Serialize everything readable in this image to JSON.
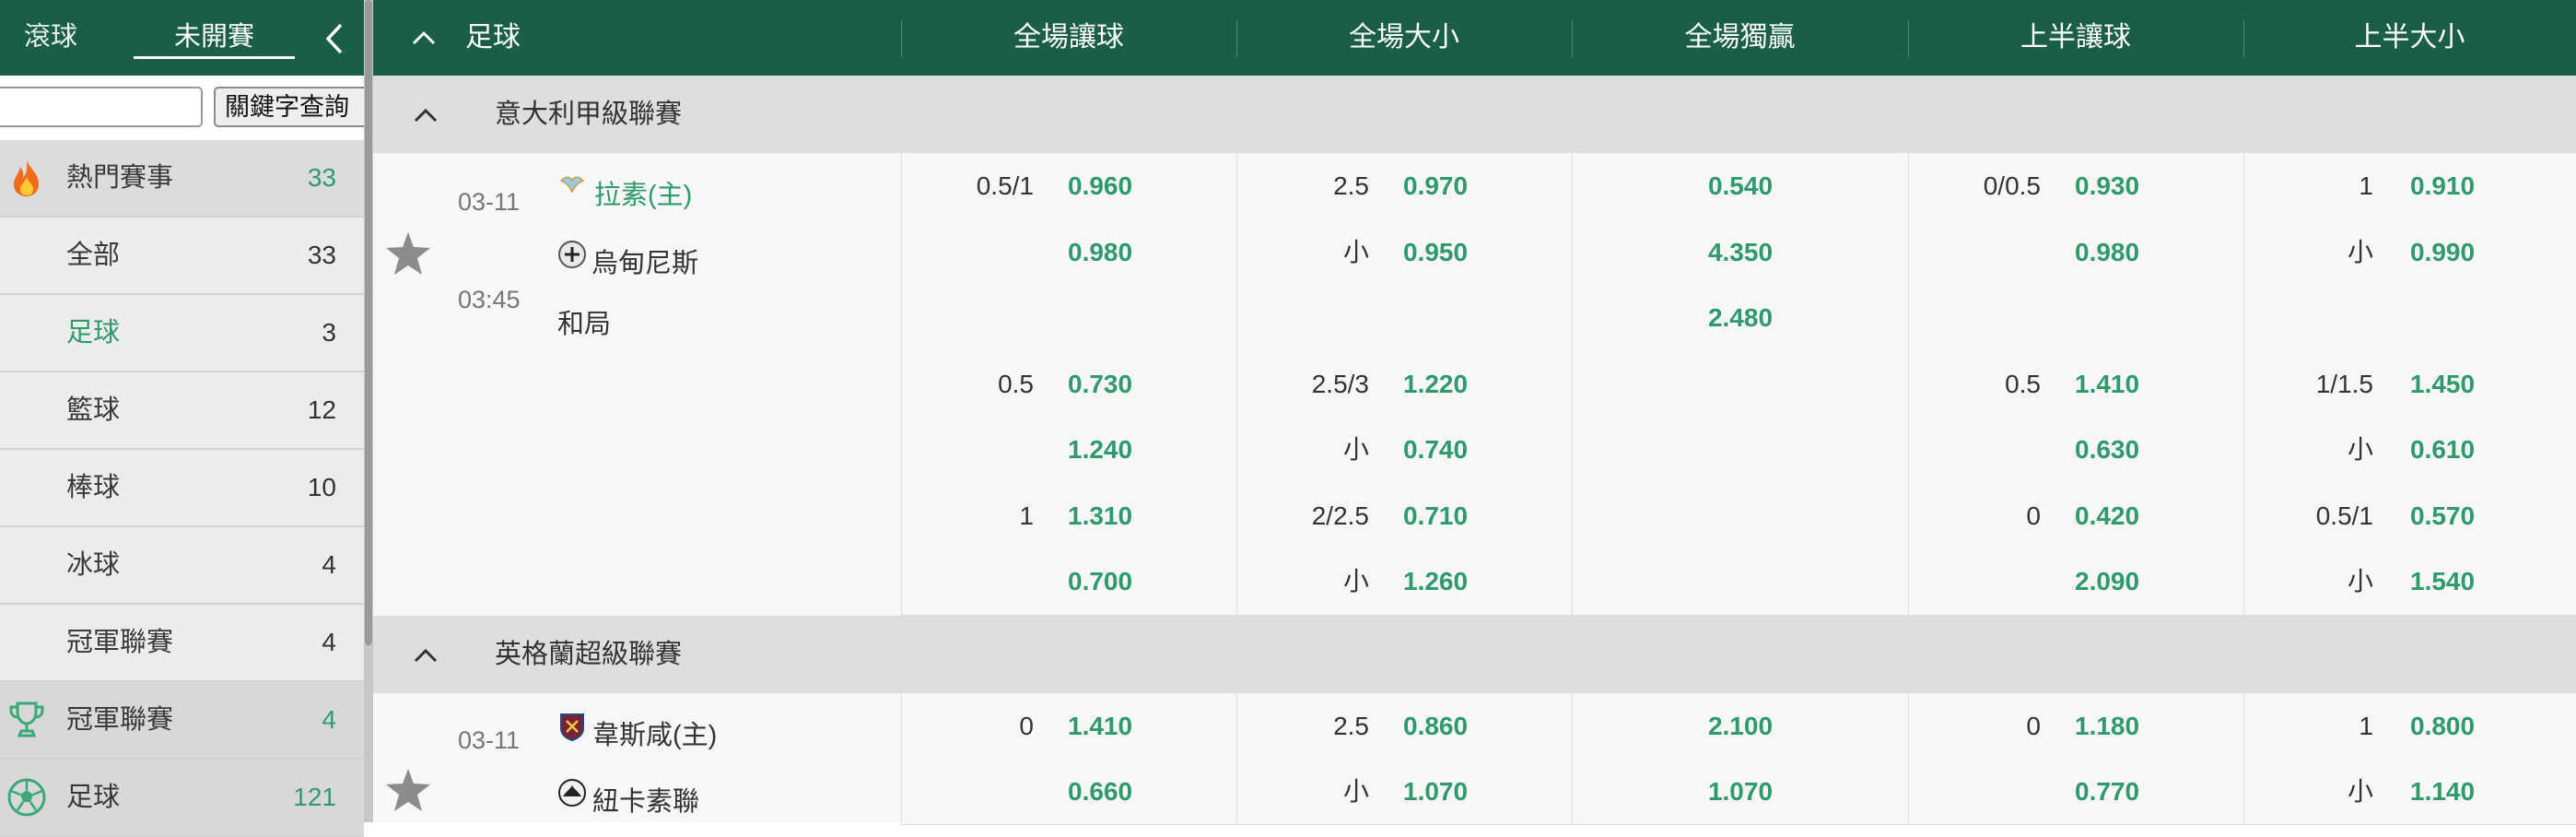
{
  "sidebar": {
    "tabs": [
      "滾球",
      "未開賽"
    ],
    "search_button": "關鍵字查詢",
    "search_placeholder": "",
    "items": [
      {
        "label": "熱門賽事",
        "count": "33",
        "icon": "fire-icon"
      },
      {
        "label": "全部",
        "count": "33"
      },
      {
        "label": "足球",
        "count": "3",
        "active": true
      },
      {
        "label": "籃球",
        "count": "12"
      },
      {
        "label": "棒球",
        "count": "10"
      },
      {
        "label": "冰球",
        "count": "4"
      },
      {
        "label": "冠軍聯賽",
        "count": "4"
      },
      {
        "label": "冠軍聯賽",
        "count": "4",
        "icon": "trophy-icon"
      },
      {
        "label": "足球",
        "count": "121",
        "icon": "soccer-ball-icon"
      }
    ]
  },
  "header": {
    "sport": "足球",
    "columns": [
      "全場讓球",
      "全場大小",
      "全場獨贏",
      "上半讓球",
      "上半大小"
    ]
  },
  "leagues": [
    {
      "name": "意大利甲級聯賽",
      "match": {
        "date": "03-11",
        "time": "03:45",
        "home": "拉素(主)",
        "away": "烏甸尼斯",
        "draw": "和局"
      },
      "rows": [
        [
          [
            "0.5/1",
            "0.960"
          ],
          [
            "2.5",
            "0.970"
          ],
          [
            "",
            "0.540"
          ],
          [
            "0/0.5",
            "0.930"
          ],
          [
            "1",
            "0.910"
          ]
        ],
        [
          [
            "",
            "0.980"
          ],
          [
            "小",
            "0.950"
          ],
          [
            "",
            "4.350"
          ],
          [
            "",
            "0.980"
          ],
          [
            "小",
            "0.990"
          ]
        ],
        [
          [
            "",
            ""
          ],
          [
            "",
            ""
          ],
          [
            "",
            "2.480"
          ],
          [
            "",
            ""
          ],
          [
            "",
            ""
          ]
        ],
        [
          [
            "0.5",
            "0.730"
          ],
          [
            "2.5/3",
            "1.220"
          ],
          [
            "",
            ""
          ],
          [
            "0.5",
            "1.410"
          ],
          [
            "1/1.5",
            "1.450"
          ]
        ],
        [
          [
            "",
            "1.240"
          ],
          [
            "小",
            "0.740"
          ],
          [
            "",
            ""
          ],
          [
            "",
            "0.630"
          ],
          [
            "小",
            "0.610"
          ]
        ],
        [
          [
            "1",
            "1.310"
          ],
          [
            "2/2.5",
            "0.710"
          ],
          [
            "",
            ""
          ],
          [
            "0",
            "0.420"
          ],
          [
            "0.5/1",
            "0.570"
          ]
        ],
        [
          [
            "",
            "0.700"
          ],
          [
            "小",
            "1.260"
          ],
          [
            "",
            ""
          ],
          [
            "",
            "2.090"
          ],
          [
            "小",
            "1.540"
          ]
        ]
      ]
    },
    {
      "name": "英格蘭超級聯賽",
      "match": {
        "date": "03-11",
        "home": "韋斯咸(主)",
        "away": "紐卡素聯"
      },
      "rows": [
        [
          [
            "0",
            "1.410"
          ],
          [
            "2.5",
            "0.860"
          ],
          [
            "",
            "2.100"
          ],
          [
            "0",
            "1.180"
          ],
          [
            "1",
            "0.800"
          ]
        ],
        [
          [
            "",
            "0.660"
          ],
          [
            "小",
            "1.070"
          ],
          [
            "",
            "1.070"
          ],
          [
            "",
            "0.770"
          ],
          [
            "小",
            "1.140"
          ]
        ]
      ]
    }
  ],
  "colors": {
    "header_green": "#1a5e45",
    "odds_green": "#2f9a6c"
  }
}
